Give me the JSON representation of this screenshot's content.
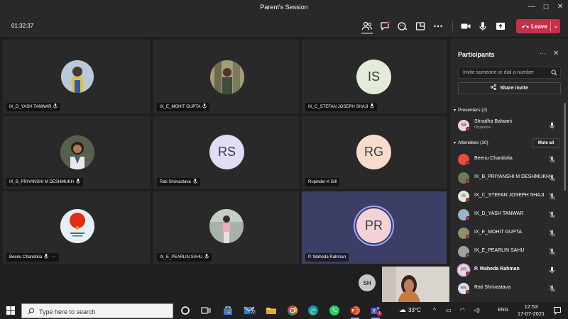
{
  "window": {
    "title": "Parent's Session",
    "minimize": "—",
    "maximize": "☐",
    "close": "✕"
  },
  "toolbar": {
    "timer": "01:32:37",
    "leave_label": "Leave",
    "leave_chevron": "⌄"
  },
  "grid": {
    "tiles": [
      {
        "name": "IX_D_YASH TANWAR",
        "type": "photo",
        "avatar_color": "#9db4c9"
      },
      {
        "name": "IX_E_MOHIT GUPTA",
        "type": "photo",
        "avatar_color": "#8a8f6e"
      },
      {
        "name": "IX_C_STEFAN JOSEPH SHAJI",
        "type": "initials",
        "initials": "IS",
        "avatar_color": "#e2ecd9"
      },
      {
        "name": "IX_B_PRIYANSHI M DESHMUKH",
        "type": "photo",
        "avatar_color": "#6f7a63"
      },
      {
        "name": "Rati Shrivastava",
        "type": "initials",
        "initials": "RS",
        "avatar_color": "#dedef6"
      },
      {
        "name": "Rupinder K Gill",
        "type": "initials",
        "initials": "RG",
        "avatar_color": "#f8dccb"
      },
      {
        "name": "Beenu Chandolia",
        "type": "photo",
        "avatar_color": "#dbe8f0"
      },
      {
        "name": "IX_E_PEARLIN SAHU",
        "type": "photo",
        "avatar_color": "#98a59a"
      },
      {
        "name": "P. Waheda Rahman",
        "type": "initials",
        "initials": "PR",
        "avatar_color": "#f4d3d7"
      }
    ],
    "more_label": "···",
    "self_initials": "SH"
  },
  "panel": {
    "title": "Participants",
    "more": "···",
    "close": "✕",
    "invite_placeholder": "Invite someone or dial a number",
    "share_invite": "Share invite",
    "presenters_header": "Presenters (2)",
    "attendees_header": "Attendees (10)",
    "mute_all": "Mute all",
    "presenters": [
      {
        "name": "Shradha Balwani",
        "role": "Organizer",
        "initials": "SB",
        "color": "#f4d3d7",
        "mic": "on"
      }
    ],
    "attendees": [
      {
        "name": "Beenu Chandolia",
        "initials": "",
        "color": "#e74c3c",
        "mic": "off",
        "bold": false
      },
      {
        "name": "IX_B_PRIYANSHI M DESHMUKH",
        "initials": "",
        "color": "#6f7a63",
        "mic": "off",
        "bold": false
      },
      {
        "name": "IX_C_STEFAN JOSEPH SHAJI",
        "initials": "IS",
        "color": "#e2ecd9",
        "mic": "off",
        "bold": false
      },
      {
        "name": "IX_D_YASH TANWAR",
        "initials": "",
        "color": "#9db4c9",
        "mic": "off",
        "bold": false
      },
      {
        "name": "IX_E_MOHIT GUPTA",
        "initials": "",
        "color": "#8a8f6e",
        "mic": "off",
        "bold": false
      },
      {
        "name": "IX_E_PEARLIN SAHU",
        "initials": "",
        "color": "#98a59a",
        "mic": "off",
        "bold": false
      },
      {
        "name": "P. Waheda Rahman",
        "initials": "PR",
        "color": "#f4d3d7",
        "mic": "on",
        "bold": true
      },
      {
        "name": "Rati Shrivastava",
        "initials": "RS",
        "color": "#dedef6",
        "mic": "off",
        "bold": false
      }
    ]
  },
  "taskbar": {
    "search_placeholder": "Type here to search",
    "mail_badge": "22",
    "teams_badge": "1",
    "weather": "33°C",
    "language": "ENG",
    "time": "12:53",
    "date": "17-07-2021"
  },
  "colors": {
    "accent": "#6264a7",
    "leave": "#c4314b",
    "panel_bg": "#292929",
    "tile_bg": "#292929",
    "highlight_tile": "#3d3e66"
  }
}
